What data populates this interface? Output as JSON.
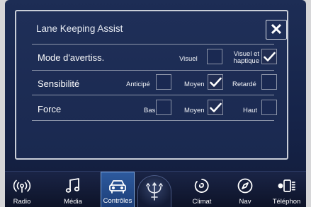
{
  "dialog": {
    "title": "Lane Keeping Assist",
    "close_label": "✕"
  },
  "rows": [
    {
      "label": "Mode d'avertiss.",
      "options": [
        {
          "label": "Visuel",
          "checked": false
        },
        {
          "label": "Visuel et haptique",
          "checked": true
        }
      ]
    },
    {
      "label": "Sensibilité",
      "options": [
        {
          "label": "Anticipé",
          "checked": false
        },
        {
          "label": "Moyen",
          "checked": true
        },
        {
          "label": "Retardé",
          "checked": false
        }
      ]
    },
    {
      "label": "Force",
      "options": [
        {
          "label": "Bas",
          "checked": false
        },
        {
          "label": "Moyen",
          "checked": true
        },
        {
          "label": "Haut",
          "checked": false
        }
      ]
    }
  ],
  "nav": {
    "items": [
      {
        "label": "Radio",
        "icon": "radio-icon",
        "active": false
      },
      {
        "label": "Média",
        "icon": "music-note-icon",
        "active": false
      },
      {
        "label": "Contrôles",
        "icon": "car-icon",
        "active": true
      },
      {
        "label": "Climat",
        "icon": "climate-fan-icon",
        "active": false
      },
      {
        "label": "Nav",
        "icon": "compass-icon",
        "active": false
      },
      {
        "label": "Téléphon",
        "icon": "phone-icon",
        "active": false
      }
    ],
    "center_logo": "trident-logo"
  },
  "colors": {
    "background": "#1a2950",
    "accent_active": "#2d5a9e",
    "text": "#ffffff"
  }
}
